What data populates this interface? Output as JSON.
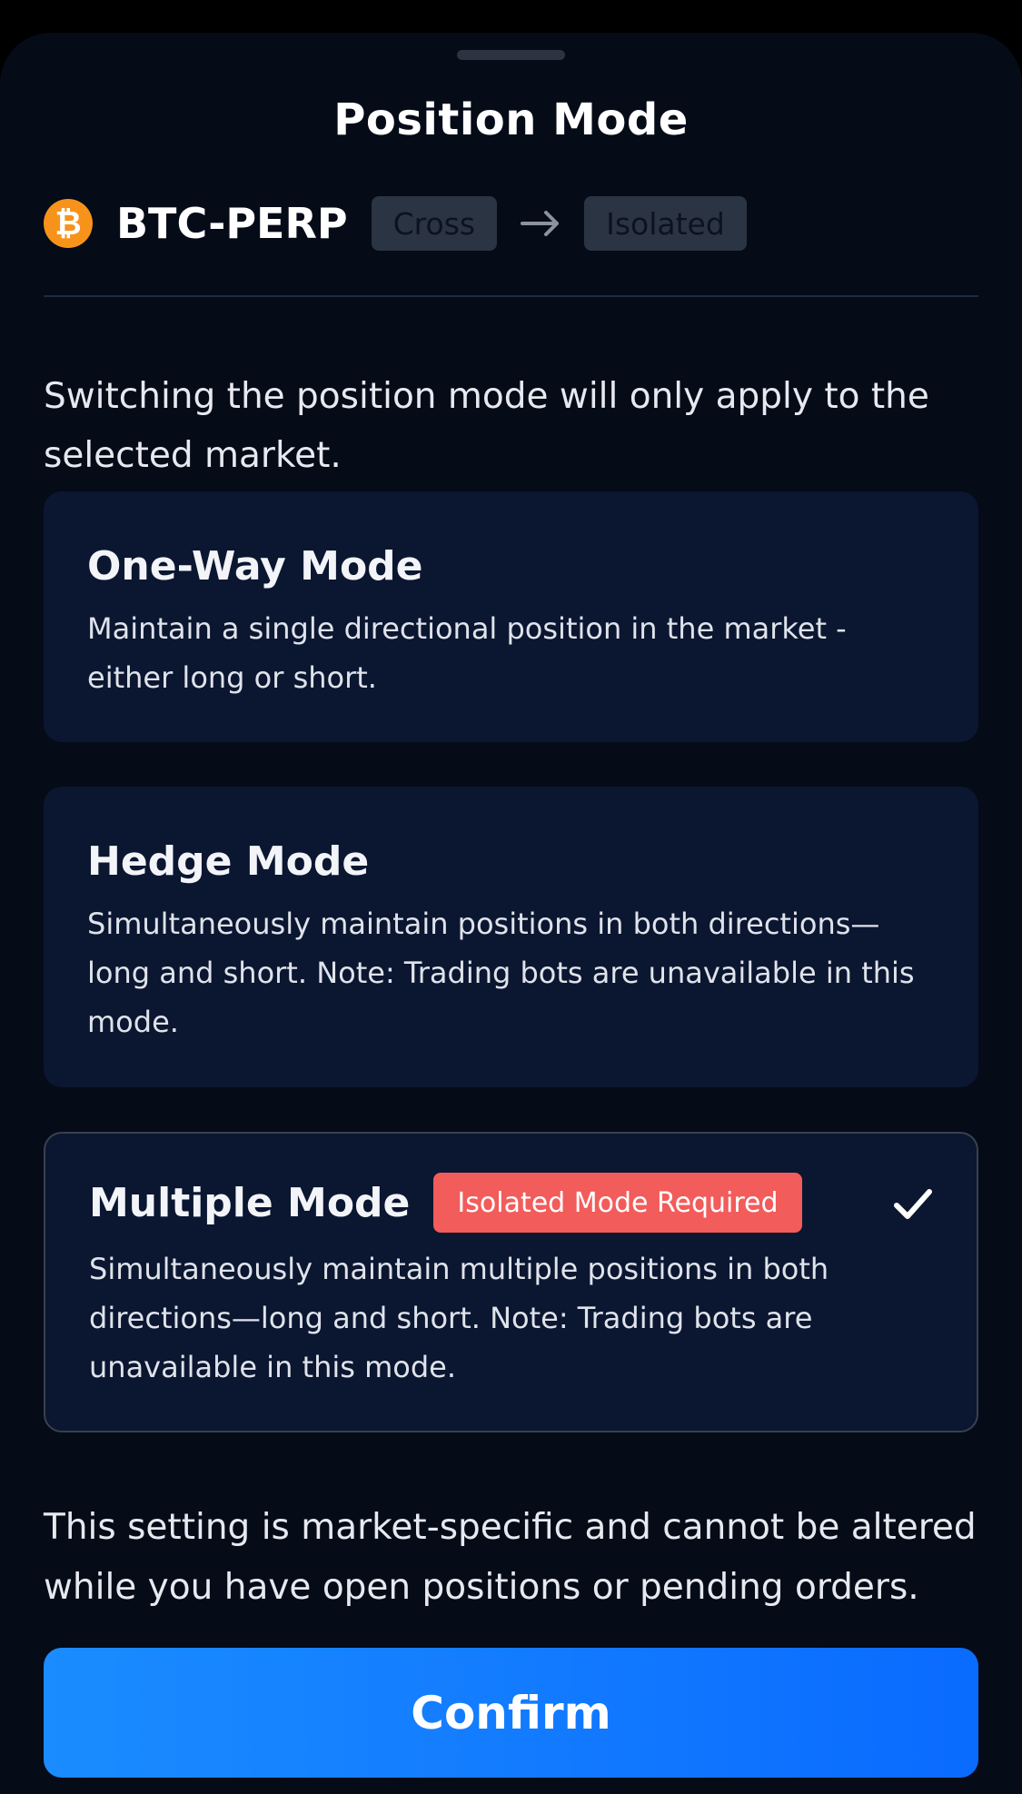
{
  "sheet": {
    "title": "Position Mode"
  },
  "market": {
    "symbol": "BTC-PERP",
    "icon": "bitcoin-icon",
    "icon_glyph": "₿",
    "from_margin": "Cross",
    "to_margin": "Isolated"
  },
  "intro_text": "Switching the position mode will only apply to the selected market.",
  "modes": [
    {
      "title": "One-Way Mode",
      "description": "Maintain a single directional position in the market - either long or short.",
      "selected": false
    },
    {
      "title": "Hedge Mode",
      "description": "Simultaneously maintain positions in both directions—long and short. Note: Trading bots are unavailable in this mode.",
      "selected": false
    },
    {
      "title": "Multiple Mode",
      "badge": "Isolated Mode Required",
      "description": "Simultaneously maintain multiple positions in both directions—long and short. Note: Trading bots are unavailable in this mode.",
      "selected": true
    }
  ],
  "note_text": "This setting is market-specific and cannot be altered while you have open positions or pending orders.",
  "confirm_label": "Confirm",
  "colors": {
    "background": "#050b17",
    "card": "#0b1631",
    "accent": "#0a6bff",
    "badge": "#f25c5a",
    "bitcoin": "#f7931a"
  }
}
